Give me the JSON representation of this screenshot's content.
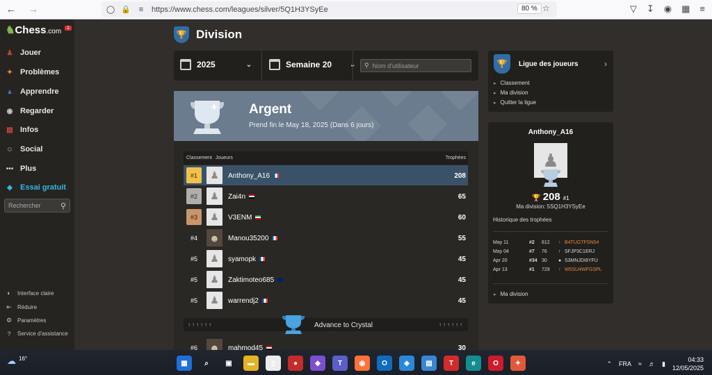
{
  "browser": {
    "url": "https://www.chess.com/leagues/silver/5Q1H3YSyEe",
    "zoom": "80 %"
  },
  "sidebar": {
    "logo": "Chess",
    "logo_suffix": ".com",
    "badge": "1",
    "items": [
      {
        "label": "Jouer",
        "icon": "play-icon",
        "color": "#b3452f"
      },
      {
        "label": "Problèmes",
        "icon": "puzzle-icon",
        "color": "#e8873a"
      },
      {
        "label": "Apprendre",
        "icon": "learn-icon",
        "color": "#3a7bbf"
      },
      {
        "label": "Regarder",
        "icon": "binoculars-icon",
        "color": "#cccccc"
      },
      {
        "label": "Infos",
        "icon": "news-icon",
        "color": "#d04a3a"
      },
      {
        "label": "Social",
        "icon": "social-icon",
        "color": "#e0a070"
      },
      {
        "label": "Plus",
        "icon": "more-icon",
        "color": "#cccccc"
      },
      {
        "label": "Essai gratuit",
        "icon": "diamond-icon",
        "color": "#34b4e8"
      }
    ],
    "search_placeholder": "Rechercher",
    "bottom": [
      {
        "label": "Interface claire",
        "icon": "contrast-icon"
      },
      {
        "label": "Réduire",
        "icon": "collapse-icon"
      },
      {
        "label": "Paramètres",
        "icon": "gear-icon"
      },
      {
        "label": "Service d'assistance",
        "icon": "help-icon"
      }
    ]
  },
  "page": {
    "title": "Division",
    "year": "2025",
    "week": "Semaine 20",
    "user_search_placeholder": "Nom d'utilisateur"
  },
  "banner": {
    "title": "Argent",
    "subtitle": "Prend fin le May 18, 2025 (Dans 6 jours)"
  },
  "table": {
    "headers": {
      "rank": "Classement",
      "players": "Joueurs",
      "trophies": "Trophées"
    },
    "rows": [
      {
        "rank": "#1",
        "name": "Anthony_A16",
        "flag": "fr",
        "trophies": "208",
        "medal": "gold",
        "avatar": "pawn",
        "active": true
      },
      {
        "rank": "#2",
        "name": "Zai4n",
        "flag": "eg",
        "trophies": "65",
        "medal": "silver",
        "avatar": "pawn"
      },
      {
        "rank": "#3",
        "name": "V3ENM",
        "flag": "ir",
        "trophies": "60",
        "medal": "bronze",
        "avatar": "pawn"
      },
      {
        "rank": "#4",
        "name": "Manou35200",
        "flag": "fr",
        "trophies": "55",
        "medal": "",
        "avatar": "photo"
      },
      {
        "rank": "#5",
        "name": "syamopk",
        "flag": "fr",
        "trophies": "45",
        "medal": "",
        "avatar": "pawn"
      },
      {
        "rank": "#5",
        "name": "Zaktimoteo685",
        "flag": "au",
        "trophies": "45",
        "medal": "",
        "avatar": "pawn"
      },
      {
        "rank": "#5",
        "name": "warrendj2",
        "flag": "fr",
        "trophies": "45",
        "medal": "",
        "avatar": "pawn"
      }
    ],
    "promotion": {
      "arrows": "↑↑↑↑↑↑",
      "label": "Advance to Crystal"
    },
    "next_row": {
      "rank": "#6",
      "name": "mahmod45",
      "flag": "eg",
      "trophies": "30",
      "avatar": "photo"
    }
  },
  "league_panel": {
    "title": "Ligue des joueurs",
    "links": [
      "Classement",
      "Ma division",
      "Quitter la ligue"
    ]
  },
  "profile": {
    "name": "Anthony_A16",
    "trophies": "208",
    "rank": "#1",
    "division": "Ma division: 5SQ1H3YSyEe",
    "history_title": "Historique des trophées",
    "history": [
      {
        "date": "May 11",
        "rank": "#2",
        "tro": "612",
        "code": "B4TUGTFSN54",
        "arrow": "↑",
        "color": "#e8873a"
      },
      {
        "date": "May 04",
        "rank": "#7",
        "tro": "76",
        "code": "SFJP3C1ERJ",
        "arrow": "↑",
        "color": "#dcdad7"
      },
      {
        "date": "Apr 20",
        "rank": "#34",
        "tro": "30",
        "code": "S3MNJDI8YFU",
        "arrow": "●",
        "color": "#dcdad7"
      },
      {
        "date": "Apr 13",
        "rank": "#1",
        "tro": "729",
        "code": "W5SU4WFGSPL",
        "arrow": "↑",
        "color": "#e8873a"
      }
    ],
    "footer_link": "Ma division"
  },
  "taskbar": {
    "temp": "16°",
    "lang": "FRA",
    "time": "04:33",
    "date": "12/05/2025",
    "apps": [
      {
        "name": "start-icon",
        "glyph": "▦",
        "bg": "#1f6fd8"
      },
      {
        "name": "search-icon",
        "glyph": "⌕",
        "bg": "transparent"
      },
      {
        "name": "taskview-icon",
        "glyph": "▣",
        "bg": "transparent"
      },
      {
        "name": "explorer-icon",
        "glyph": "▬",
        "bg": "#e6b325"
      },
      {
        "name": "notepad-icon",
        "glyph": "▯",
        "bg": "#ececec"
      },
      {
        "name": "record-icon",
        "glyph": "●",
        "bg": "#c42b2b"
      },
      {
        "name": "m365-icon",
        "glyph": "◆",
        "bg": "#7b4fd1"
      },
      {
        "name": "teams-icon",
        "glyph": "T",
        "bg": "#5b5fc7"
      },
      {
        "name": "firefox-icon",
        "glyph": "◉",
        "bg": "#ff7139"
      },
      {
        "name": "outlook-icon",
        "glyph": "O",
        "bg": "#0f6cbd"
      },
      {
        "name": "app-icon",
        "glyph": "◈",
        "bg": "#2b88d8"
      },
      {
        "name": "store-icon",
        "glyph": "▤",
        "bg": "#3a86d6"
      },
      {
        "name": "tlc-icon",
        "glyph": "T",
        "bg": "#d02c2c"
      },
      {
        "name": "edge-icon",
        "glyph": "e",
        "bg": "#138d8f"
      },
      {
        "name": "opera-icon",
        "glyph": "O",
        "bg": "#cc1b2b"
      },
      {
        "name": "tools-icon",
        "glyph": "✦",
        "bg": "#e05a3a"
      }
    ]
  }
}
